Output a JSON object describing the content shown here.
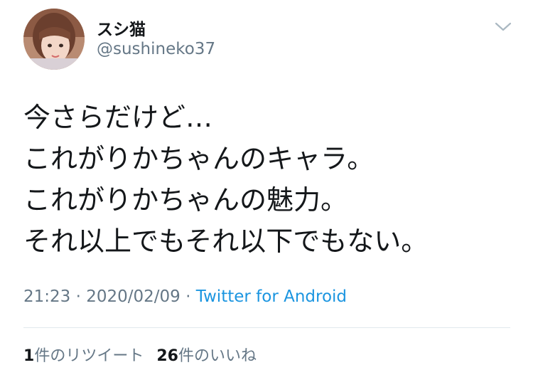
{
  "user": {
    "display_name": "スシ猫",
    "handle": "@sushineko37",
    "avatar_icon": "profile-photo"
  },
  "menu": {
    "icon": "chevron-down-icon"
  },
  "tweet": {
    "lines": [
      "今さらだけど…",
      "これがりかちゃんのキャラ。",
      "これがりかちゃんの魅力。",
      "それ以上でもそれ以下でもない。"
    ]
  },
  "meta": {
    "time": "21:23",
    "separator": "·",
    "date": "2020/02/09",
    "source": "Twitter for Android"
  },
  "stats": {
    "retweet_count": "1",
    "retweet_label": "件のリツイート",
    "like_count": "26",
    "like_label": "件のいいね"
  },
  "colors": {
    "text": "#14171a",
    "secondary": "#657786",
    "link": "#1b95e0",
    "divider": "#e1e8ed"
  }
}
